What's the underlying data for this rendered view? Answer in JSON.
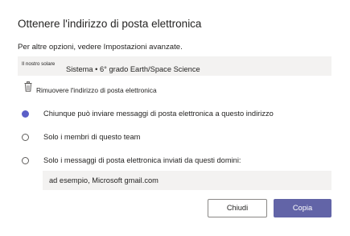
{
  "dialog": {
    "title": "Ottenere l'indirizzo di posta elettronica",
    "subtitle": "Per altre opzioni, vedere Impostazioni avanzate."
  },
  "email": {
    "prefix": "Il nostro solare",
    "team": "Sistema • 6° grado Earth/Space Science"
  },
  "remove": {
    "icon": "trash-icon",
    "label": "Rimuovere l'indirizzo di posta elettronica"
  },
  "options": [
    {
      "label": "Chiunque può inviare messaggi di posta elettronica a questo indirizzo",
      "selected": true
    },
    {
      "label": "Solo i membri di questo team",
      "selected": false
    },
    {
      "label": "Solo i messaggi di posta elettronica inviati da questi domini:",
      "selected": false
    }
  ],
  "domains": {
    "placeholder": "ad esempio, Microsoft gmail.com",
    "value": ""
  },
  "buttons": {
    "close": "Chiudi",
    "copy": "Copia"
  },
  "colors": {
    "accent": "#6264a7",
    "radio_selected": "#5b5fc7",
    "field_background": "#f3f2f1"
  }
}
